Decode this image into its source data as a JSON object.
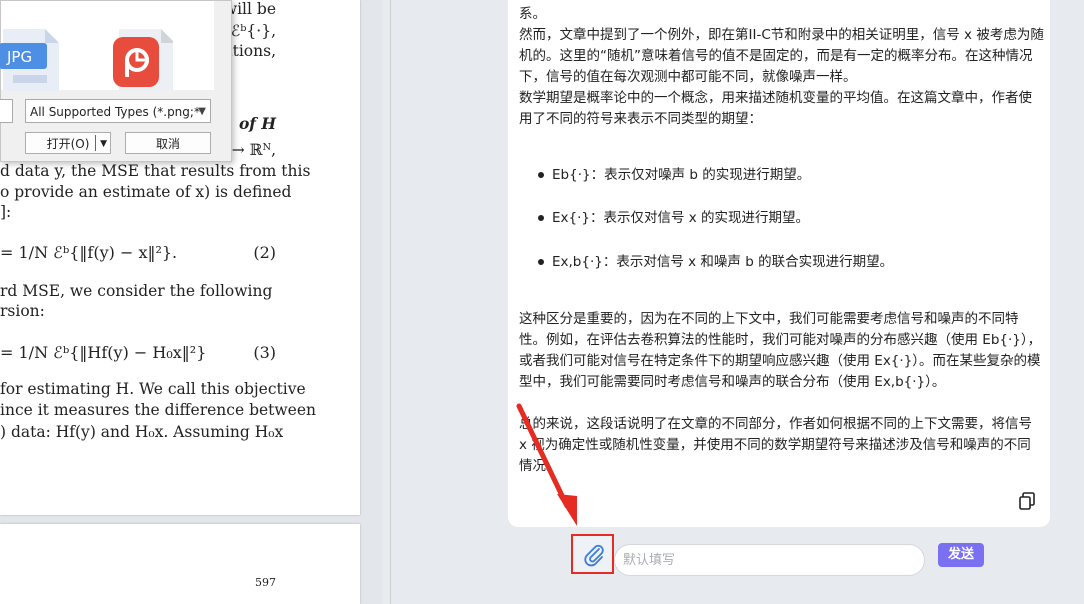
{
  "document": {
    "page1_lines": [
      "will be",
      ": ℰᵇ{·},",
      "ations,",
      "of H",
      "→ ℝᴺ,",
      "d data y, the MSE that results from this",
      "o provide an estimate of x) is defined",
      "]:",
      "rd MSE, we consider the following",
      "rsion:",
      "for estimating H. We call this objective",
      "ince it measures the difference between",
      ") data: Hf(y) and H₀x. Assuming H₀x"
    ],
    "eq2": "= 1/N ℰᵇ{‖f(y) − x‖²}.",
    "eq2_num": "(2)",
    "eq3": "= 1/N ℰᵇ{‖Hf(y) − H₀x‖²}",
    "eq3_num": "(3)",
    "page_number": "597"
  },
  "dialog": {
    "icons": [
      "jpg-file-icon",
      "ppt-file-icon"
    ],
    "jpg_label": "JPG",
    "file_type": "All Supported Types (*.png;*",
    "open_label": "打开(O)",
    "cancel_label": "取消"
  },
  "answer": {
    "p0": "系。",
    "p1": "然而，文章中提到了一个例外，即在第II-C节和附录中的相关证明里，信号 x 被考虑为随机的。这里的“随机”意味着信号的值不是固定的，而是有一定的概率分布。在这种情况下，信号的值在每次观测中都可能不同，就像噪声一样。",
    "p2": "数学期望是概率论中的一个概念，用来描述随机变量的平均值。在这篇文章中，作者使用了不同的符号来表示不同类型的期望：",
    "bullets": [
      "Eb{·}：表示仅对噪声 b 的实现进行期望。",
      "Ex{·}：表示仅对信号 x 的实现进行期望。",
      "Ex,b{·}：表示对信号 x 和噪声 b 的联合实现进行期望。"
    ],
    "p3": "这种区分是重要的，因为在不同的上下文中，我们可能需要考虑信号和噪声的不同特性。例如，在评估去卷积算法的性能时，我们可能对噪声的分布感兴趣（使用 Eb{·}），或者我们可能对信号在特定条件下的期望响应感兴趣（使用 Ex{·}）。而在某些复杂的模型中，我们可能需要同时考虑信号和噪声的联合分布（使用 Ex,b{·}）。",
    "p4": "总的来说，这段话说明了在文章的不同部分，作者如何根据不同的上下文需要，将信号 x 视为确定性或随机性变量，并使用不同的数学期望符号来描述涉及信号和噪声的不同情况。"
  },
  "input": {
    "placeholder": "默认填写",
    "value": "",
    "send_label": "发送"
  },
  "colors": {
    "send": "#7b6ff2",
    "highlight": "#e52b22",
    "attach_icon": "#3b7ddd"
  }
}
